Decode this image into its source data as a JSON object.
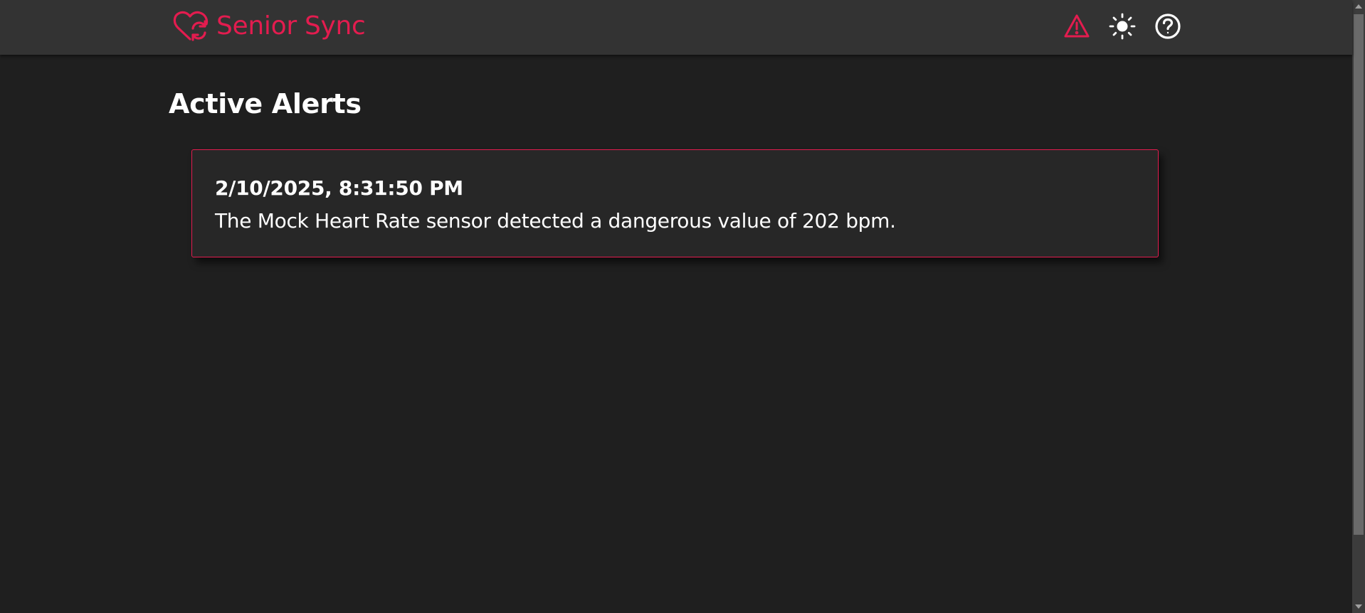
{
  "app": {
    "name": "Senior Sync",
    "brand_color": "#e31c4f"
  },
  "header": {
    "icons": [
      "heart-sync-logo-icon",
      "alert-triangle-icon",
      "sun-icon",
      "help-circle-icon"
    ]
  },
  "main": {
    "title": "Active Alerts",
    "alerts": [
      {
        "timestamp": "2/10/2025, 8:31:50 PM",
        "message": "The Mock Heart Rate sensor detected a dangerous value of 202 bpm."
      }
    ]
  },
  "colors": {
    "background": "#1f1f1f",
    "navbar": "#333333",
    "card": "#272727",
    "accent": "#e31c4f",
    "text": "#ffffff"
  }
}
